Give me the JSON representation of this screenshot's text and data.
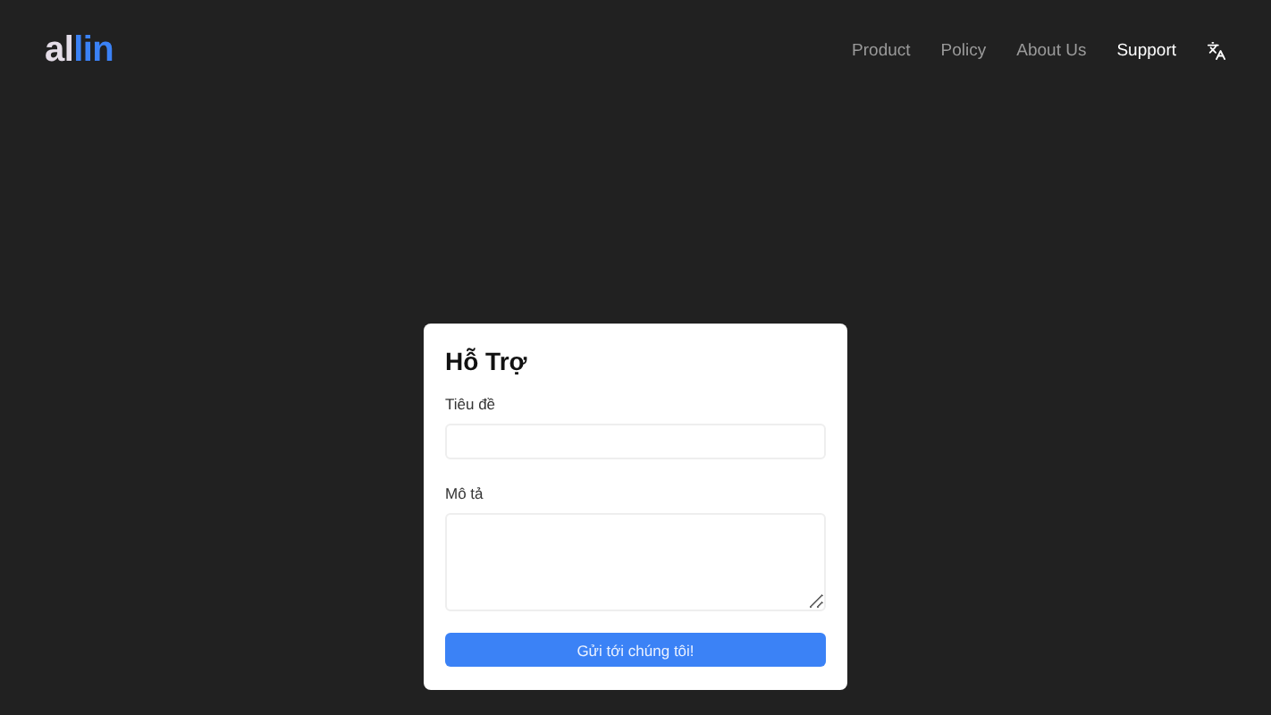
{
  "logo": {
    "parts": [
      {
        "text": "al",
        "color": "#e4dde8"
      },
      {
        "text": "lin",
        "color": "#3b82f6"
      }
    ]
  },
  "nav": [
    {
      "label": "Product",
      "selected": false
    },
    {
      "label": "Policy",
      "selected": false
    },
    {
      "label": "About Us",
      "selected": false
    },
    {
      "label": "Support",
      "selected": true
    }
  ],
  "form": {
    "title": "Hỗ Trợ",
    "fields": [
      {
        "kind": "input",
        "label": "Tiêu đề"
      },
      {
        "kind": "textarea",
        "label": "Mô tả"
      }
    ],
    "submit": "Gửi tới chúng tôi!"
  }
}
